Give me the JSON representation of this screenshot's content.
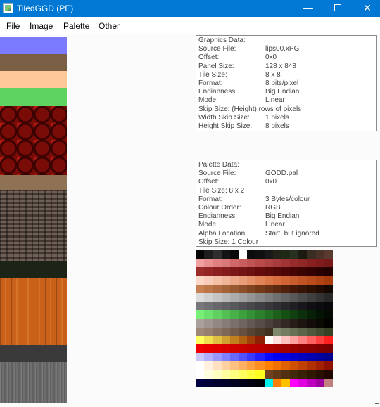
{
  "window": {
    "title": "TiledGGD (PE)",
    "minimize_glyph": "—",
    "close_glyph": "✕"
  },
  "menu": [
    "File",
    "Image",
    "Palette",
    "Other"
  ],
  "graphics_panel": {
    "rows": [
      [
        "Graphics Data:",
        ""
      ],
      [
        "Source File:",
        "lips00.xPG"
      ],
      [
        "Offset:",
        "0x0"
      ],
      [
        "Panel Size:",
        "128 x 848"
      ],
      [
        "Tile Size:",
        "8 x 8"
      ],
      [
        "Format:",
        "8 bits/pixel"
      ],
      [
        "Endianness:",
        "Big Endian"
      ],
      [
        "Mode:",
        "Linear"
      ],
      [
        "Skip Size: (Height) rows of pixels",
        ""
      ],
      [
        "Width Skip Size:",
        "1 pixels"
      ],
      [
        "Height Skip Size:",
        "8 pixels"
      ]
    ]
  },
  "palette_panel": {
    "rows": [
      [
        "Palette Data:",
        ""
      ],
      [
        "Source File:",
        "GODD.pal"
      ],
      [
        "Offset:",
        "0x0"
      ],
      [
        "Tile Size:  8 x 2",
        ""
      ],
      [
        "Format:",
        "3 Bytes/colour"
      ],
      [
        "Colour Order:",
        "RGB"
      ],
      [
        "Endianness:",
        "Big Endian"
      ],
      [
        "Mode:",
        "Linear"
      ],
      [
        "Alpha Location:",
        "Start, but ignored"
      ],
      [
        "Skip Size: 1 Colour",
        ""
      ]
    ]
  },
  "tile_bands": [
    {
      "kind": "solid",
      "color": "#7b7bff"
    },
    {
      "kind": "solid",
      "color": "#7a5f45"
    },
    {
      "kind": "solid",
      "color": "#ffc89a"
    },
    {
      "kind": "solid",
      "color": "#5fd35f"
    },
    {
      "kind": "red-circles",
      "color": "#7a0c08"
    },
    {
      "kind": "solid",
      "color": "#8f7253"
    },
    {
      "kind": "stone-wall",
      "color": "#5a4a40"
    },
    {
      "kind": "solid",
      "color": "#1c2418"
    },
    {
      "kind": "wood",
      "color": "#c9611a"
    },
    {
      "kind": "solid",
      "color": "#3a3a3a"
    },
    {
      "kind": "metal",
      "color": "#6e6e6e"
    }
  ],
  "palette_rows": [
    [
      "#050505",
      "#1c1c1c",
      "#2e2e2e",
      "#141414",
      "#0a0a0a",
      "#ffffff",
      "#0c0c0c",
      "#101010",
      "#181818",
      "#222218",
      "#1e2a16",
      "#2a3020",
      "#1a1a10",
      "#3a2e22",
      "#4a3226",
      "#5a3a2e"
    ],
    [
      "#f0a0a0",
      "#e89090",
      "#e08080",
      "#d87878",
      "#d06868",
      "#c85e5e",
      "#c05454",
      "#b84a4a",
      "#b04444",
      "#a83c3c",
      "#a03434",
      "#982c2c",
      "#902828",
      "#882020",
      "#801c1c",
      "#781818"
    ],
    [
      "#9c2c2c",
      "#942626",
      "#8c2020",
      "#841c1c",
      "#7c1818",
      "#741414",
      "#6c1010",
      "#640c0c",
      "#5c0a0a",
      "#540808",
      "#4c0606",
      "#440404",
      "#3c0303",
      "#340202",
      "#2c0101",
      "#240000"
    ],
    [
      "#fcd8c8",
      "#f8ccb8",
      "#f4c0a8",
      "#f0b498",
      "#eca888",
      "#e89c78",
      "#e49068",
      "#e08458",
      "#dc7848",
      "#d86c3c",
      "#d06434",
      "#c85c2c",
      "#c05424",
      "#b84c1c",
      "#b04414",
      "#a83c0c"
    ],
    [
      "#c88050",
      "#bc7648",
      "#b06c40",
      "#a46238",
      "#985830",
      "#8c4e28",
      "#804420",
      "#743a18",
      "#683014",
      "#5c2810",
      "#50200c",
      "#441808",
      "#381406",
      "#2c1004",
      "#200c02",
      "#140800"
    ],
    [
      "#dcdcdc",
      "#d0d0d0",
      "#c4c4c4",
      "#b8b8b8",
      "#acacac",
      "#a0a0a0",
      "#949494",
      "#888888",
      "#7c7c7c",
      "#707070",
      "#646464",
      "#585858",
      "#4c4c4c",
      "#404040",
      "#343434",
      "#282828"
    ],
    [
      "#78787c",
      "#707074",
      "#68686c",
      "#606064",
      "#58585c",
      "#505054",
      "#48484c",
      "#404044",
      "#38383c",
      "#303034",
      "#28282c",
      "#202024",
      "#18181c",
      "#101014",
      "#0c0c10",
      "#08080c"
    ],
    [
      "#78f078",
      "#6ce06c",
      "#60d060",
      "#54c054",
      "#48b048",
      "#3ca03c",
      "#349034",
      "#2c802c",
      "#247024",
      "#1c601c",
      "#145014",
      "#104010",
      "#0c300c",
      "#082008",
      "#041404",
      "#020a02"
    ],
    [
      "#aca09c",
      "#a09490",
      "#948884",
      "#887c78",
      "#7c706c",
      "#706460",
      "#645854",
      "#584c48",
      "#4c403c",
      "#403430",
      "#342824",
      "#281c18",
      "#1c1410",
      "#140c08",
      "#0c0804",
      "#040200"
    ],
    [
      "#a08878",
      "#94806c",
      "#887460",
      "#7c6854",
      "#705c48",
      "#64503c",
      "#584430",
      "#4c3a28",
      "#403020",
      "#80886c",
      "#747c60",
      "#687054",
      "#5c6448",
      "#50583c",
      "#444c30",
      "#384024"
    ],
    [
      "#ffff60",
      "#f0e050",
      "#e0c040",
      "#d0a030",
      "#c08020",
      "#b06010",
      "#a04008",
      "#902004",
      "#ffffff",
      "#ffe0e0",
      "#ffc0c0",
      "#ffa0a0",
      "#ff8080",
      "#ff6060",
      "#ff4040",
      "#ff2020"
    ],
    [
      "#f00000",
      "#e80000",
      "#e00000",
      "#d80000",
      "#d00000",
      "#c80000",
      "#c00000",
      "#b80000",
      "#b00000",
      "#a80000",
      "#a00000",
      "#980000",
      "#900000",
      "#880000",
      "#800000",
      "#780000"
    ],
    [
      "#c8c8ff",
      "#b0b0ff",
      "#9898ff",
      "#8080ff",
      "#6868ff",
      "#5050ff",
      "#3838ff",
      "#2020ff",
      "#0808ff",
      "#0000f0",
      "#0000e0",
      "#0000d0",
      "#0000c0",
      "#0000b0",
      "#0000a0",
      "#000090"
    ],
    [
      "#ffffff",
      "#fff0e0",
      "#ffe0c0",
      "#ffd0a0",
      "#ffc080",
      "#ffb060",
      "#ffa040",
      "#ff9020",
      "#ff8000",
      "#f07000",
      "#e06000",
      "#d05000",
      "#c04000",
      "#b03000",
      "#a02000",
      "#901000"
    ],
    [
      "#ffffff",
      "#ffffe0",
      "#ffffc0",
      "#ffffa0",
      "#ffff80",
      "#ffff60",
      "#ffff40",
      "#ffff20",
      "#704020",
      "#603818",
      "#503010",
      "#402808",
      "#382004",
      "#301800",
      "#281000",
      "#200800"
    ],
    [
      "#000040",
      "#000038",
      "#000030",
      "#000028",
      "#000020",
      "#000018",
      "#000010",
      "#000008",
      "#00f0f0",
      "#ff8000",
      "#ffc000",
      "#ff00ff",
      "#e000e0",
      "#c000c0",
      "#a000a0",
      "#c08080"
    ]
  ]
}
